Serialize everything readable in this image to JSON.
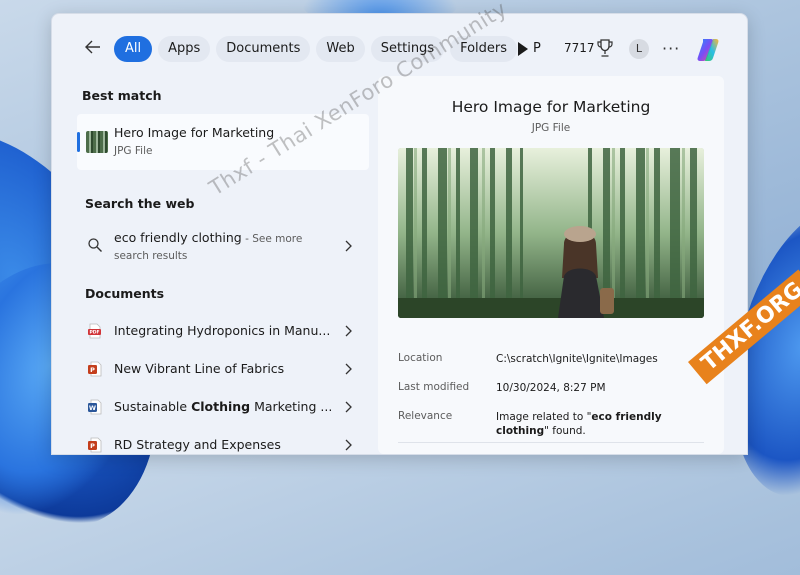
{
  "search": {
    "filters": [
      "All",
      "Apps",
      "Documents",
      "Web",
      "Settings",
      "Folders",
      "P"
    ],
    "active_filter": "All",
    "points": "7717",
    "avatar_initial": "L"
  },
  "results": {
    "best_match": {
      "heading": "Best match",
      "name": "Hero Image for Marketing",
      "type": "JPG File"
    },
    "web": {
      "heading": "Search the web",
      "query": "eco friendly clothing",
      "see_more": " - See more",
      "sub": "search results"
    },
    "documents": {
      "heading": "Documents",
      "items": [
        {
          "label": "Integrating Hydroponics in Manu...",
          "icon": "pdf-icon"
        },
        {
          "label": "New Vibrant Line of Fabrics",
          "icon": "powerpoint-icon"
        },
        {
          "label_prefix": "Sustainable ",
          "label_bold": "Clothing",
          "label_suffix": " Marketing ...",
          "icon": "word-icon"
        },
        {
          "label": "RD Strategy and Expenses",
          "icon": "powerpoint-icon"
        }
      ]
    }
  },
  "preview": {
    "title": "Hero Image for Marketing",
    "type": "JPG File",
    "location_label": "Location",
    "location_value": "C:\\scratch\\Ignite\\Ignite\\Images",
    "modified_label": "Last modified",
    "modified_value": "10/30/2024, 8:27 PM",
    "relevance_label": "Relevance",
    "relevance_prefix": "Image related to \"",
    "relevance_bold": "eco friendly clothing",
    "relevance_suffix": "\" found."
  },
  "watermark": {
    "text": "Thxf - Thai XenForo Community",
    "badge": "THXF.ORG"
  },
  "colors": {
    "accent": "#1f6fe0",
    "pdf": "#d13438",
    "powerpoint": "#c43e1c",
    "word": "#2b579a"
  }
}
